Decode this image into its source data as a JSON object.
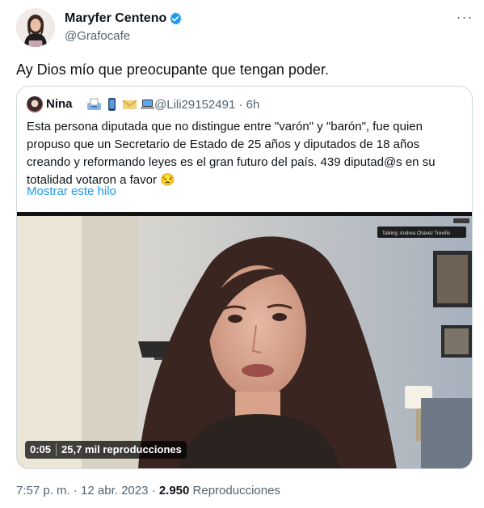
{
  "tweet": {
    "author_name": "Maryfer Centeno",
    "author_handle": "@Grafocafe",
    "text": "Ay Dios mío que preocupante que tengan poder.",
    "time": "7:57 p. m.",
    "separator": "·",
    "date": "12 abr. 2023",
    "views_count": "2.950",
    "views_label": "Reproducciones",
    "icons": {
      "verified": "verified-badge-icon",
      "more": "more-options-icon"
    },
    "colors": {
      "verified": "#1d9bf0",
      "link": "#1d9bf0",
      "muted": "#536471"
    }
  },
  "quoted": {
    "author_name": "Nina",
    "emojis": [
      "inbox-tray-icon",
      "mobile-phone-icon",
      "envelope-icon",
      "laptop-icon"
    ],
    "handle": "@Lili29152491 · 6h",
    "text": "Esta persona diputada que no distingue entre \"varón\" y \"barón\", fue quien propuso que un Secretario de Estado de 25 años y diputados de 18 años creando y reformando leyes es el gran futuro del país. 439 diputad@s en su totalidad votaron a favor 😒",
    "show_thread": "Mostrar este hilo",
    "video": {
      "duration": "0:05",
      "views": "25,7 mil reproducciones",
      "overlay_label": "Talking: Andrea Chávez Treviño"
    }
  }
}
